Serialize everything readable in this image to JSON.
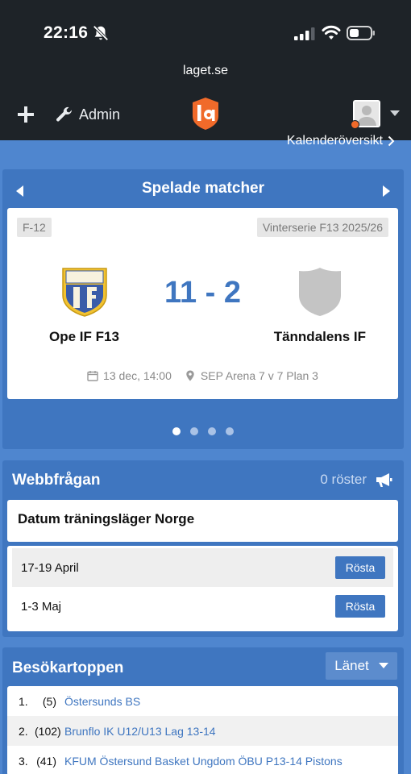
{
  "status_bar": {
    "time": "22:16"
  },
  "browser": {
    "url": "laget.se"
  },
  "site_nav": {
    "admin_label": "Admin"
  },
  "calendar_link": "Kalenderöversikt",
  "matches": {
    "title": "Spelade matcher",
    "card": {
      "left_tag": "F-12",
      "right_tag": "Vinterserie F13 2025/26",
      "home_team": "Ope IF F13",
      "away_team": "Tänndalens IF",
      "score": "11 - 2",
      "date": "13 dec, 14:00",
      "venue": "SEP Arena 7 v 7 Plan 3"
    },
    "pager": {
      "total": 4,
      "active": 1
    }
  },
  "poll": {
    "title": "Webbfrågan",
    "votes": "0 röster",
    "question": "Datum träningsläger Norge",
    "options": [
      {
        "label": "17-19 April",
        "button": "Rösta"
      },
      {
        "label": "1-3 Maj",
        "button": "Rösta"
      }
    ]
  },
  "top_visitors": {
    "title": "Besökartoppen",
    "region": "Länet",
    "rows": [
      {
        "pos": "1.",
        "prev": "(5)",
        "name": "Östersunds BS"
      },
      {
        "pos": "2.",
        "prev": "(102)",
        "name": "Brunflo IK U12/U13 Lag 13-14"
      },
      {
        "pos": "3.",
        "prev": "(41)",
        "name": "KFUM Östersund Basket Ungdom ÖBU P13-14 Pistons"
      }
    ]
  },
  "colors": {
    "accent_blue": "#3f76c0",
    "page_blue": "#4f86cf",
    "header_dark": "#1e2328",
    "logo_orange": "#f06a2a"
  },
  "icons": [
    "bell-slash-icon",
    "signal-icon",
    "wifi-icon",
    "battery-icon",
    "plus-icon",
    "wrench-icon",
    "laget-logo",
    "avatar-icon",
    "chevron-down-icon",
    "chevron-right-icon",
    "arrow-left-icon",
    "arrow-right-icon",
    "calendar-icon",
    "location-pin-icon",
    "megaphone-icon"
  ]
}
